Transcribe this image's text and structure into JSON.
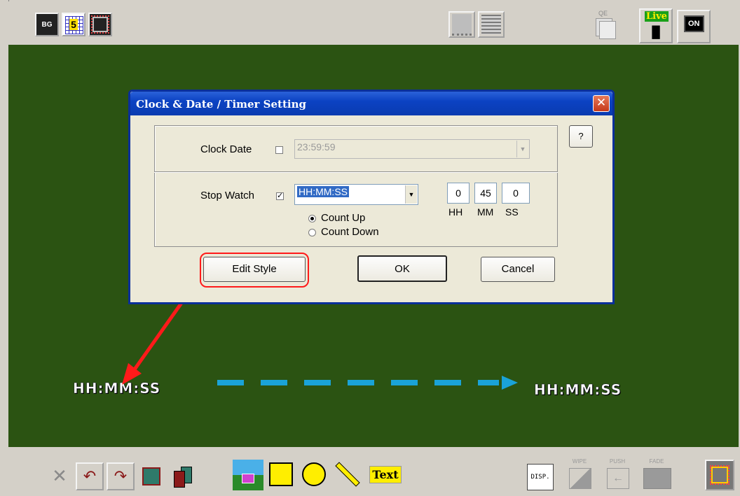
{
  "toolbar": {
    "bg_label": "BG",
    "num_label": "5",
    "live_label": "Live",
    "on_label": "ON",
    "qe_label": "QE"
  },
  "dialog": {
    "title": "Clock & Date / Timer  Setting",
    "help_label": "?",
    "clock_date_label": "Clock  Date",
    "clock_date_checked": false,
    "clock_date_value": "23:59:59",
    "stop_watch_label": "Stop Watch",
    "stop_watch_checked": true,
    "stop_watch_format": "HH:MM:SS",
    "hh_value": "0",
    "mm_value": "45",
    "ss_value": "0",
    "hh_label": "HH",
    "mm_label": "MM",
    "ss_label": "SS",
    "count_up_label": "Count Up",
    "count_down_label": "Count Down",
    "count_mode": "Count Up",
    "edit_style_label": "Edit Style",
    "ok_label": "OK",
    "cancel_label": "Cancel"
  },
  "canvas": {
    "left_text": "HH:MM:SS",
    "right_text": "HH:MM:SS",
    "annotation_arrow_color": "#ff1a1a",
    "dashed_arrow_color": "#1aa3d8"
  },
  "bottom": {
    "text_tool_label": "Text",
    "disp_label": "DISP.",
    "wipe_label": "WIPE",
    "push_label": "PUSH",
    "fade_label": "FADE"
  },
  "colors": {
    "canvas_bg": "#2b5312",
    "title_blue": "#0b42c3"
  }
}
